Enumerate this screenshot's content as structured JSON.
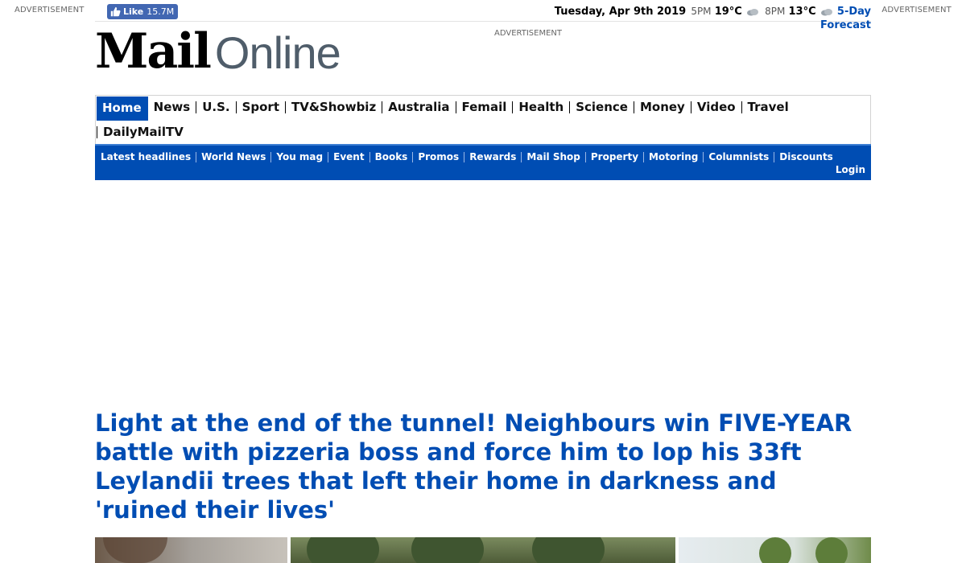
{
  "ads": {
    "left": "ADVERTISEMENT",
    "right": "ADVERTISEMENT",
    "middle": "ADVERTISEMENT"
  },
  "facebook": {
    "like_label": "Like",
    "like_count": "15.7M"
  },
  "weather": {
    "date": "Tuesday, Apr 9th 2019",
    "time1": "5PM",
    "temp1": "19°C",
    "time2": "8PM",
    "temp2": "13°C",
    "forecast_link_part1": "5-Day",
    "forecast_link_part2": "Forecast"
  },
  "logo": {
    "word1": "Mail",
    "word2": "Online"
  },
  "nav_primary": {
    "home": "Home",
    "items": [
      "News",
      "U.S.",
      "Sport",
      "TV&Showbiz",
      "Australia",
      "Femail",
      "Health",
      "Science",
      "Money",
      "Video",
      "Travel"
    ],
    "row2": [
      "DailyMailTV"
    ]
  },
  "nav_secondary": {
    "items": [
      "Latest headlines",
      "World News",
      "You mag",
      "Event",
      "Books",
      "Promos",
      "Rewards",
      "Mail Shop",
      "Property",
      "Motoring",
      "Columnists",
      "Discounts"
    ],
    "login": "Login"
  },
  "article": {
    "headline": "Light at the end of the tunnel! Neighbours win FIVE-YEAR battle with pizzeria boss and force him to lop his 33ft Leylandii trees that left their home in darkness and 'ruined their lives'"
  },
  "colors": {
    "accent": "#004db3",
    "logo_online": "#4f5d6a"
  }
}
